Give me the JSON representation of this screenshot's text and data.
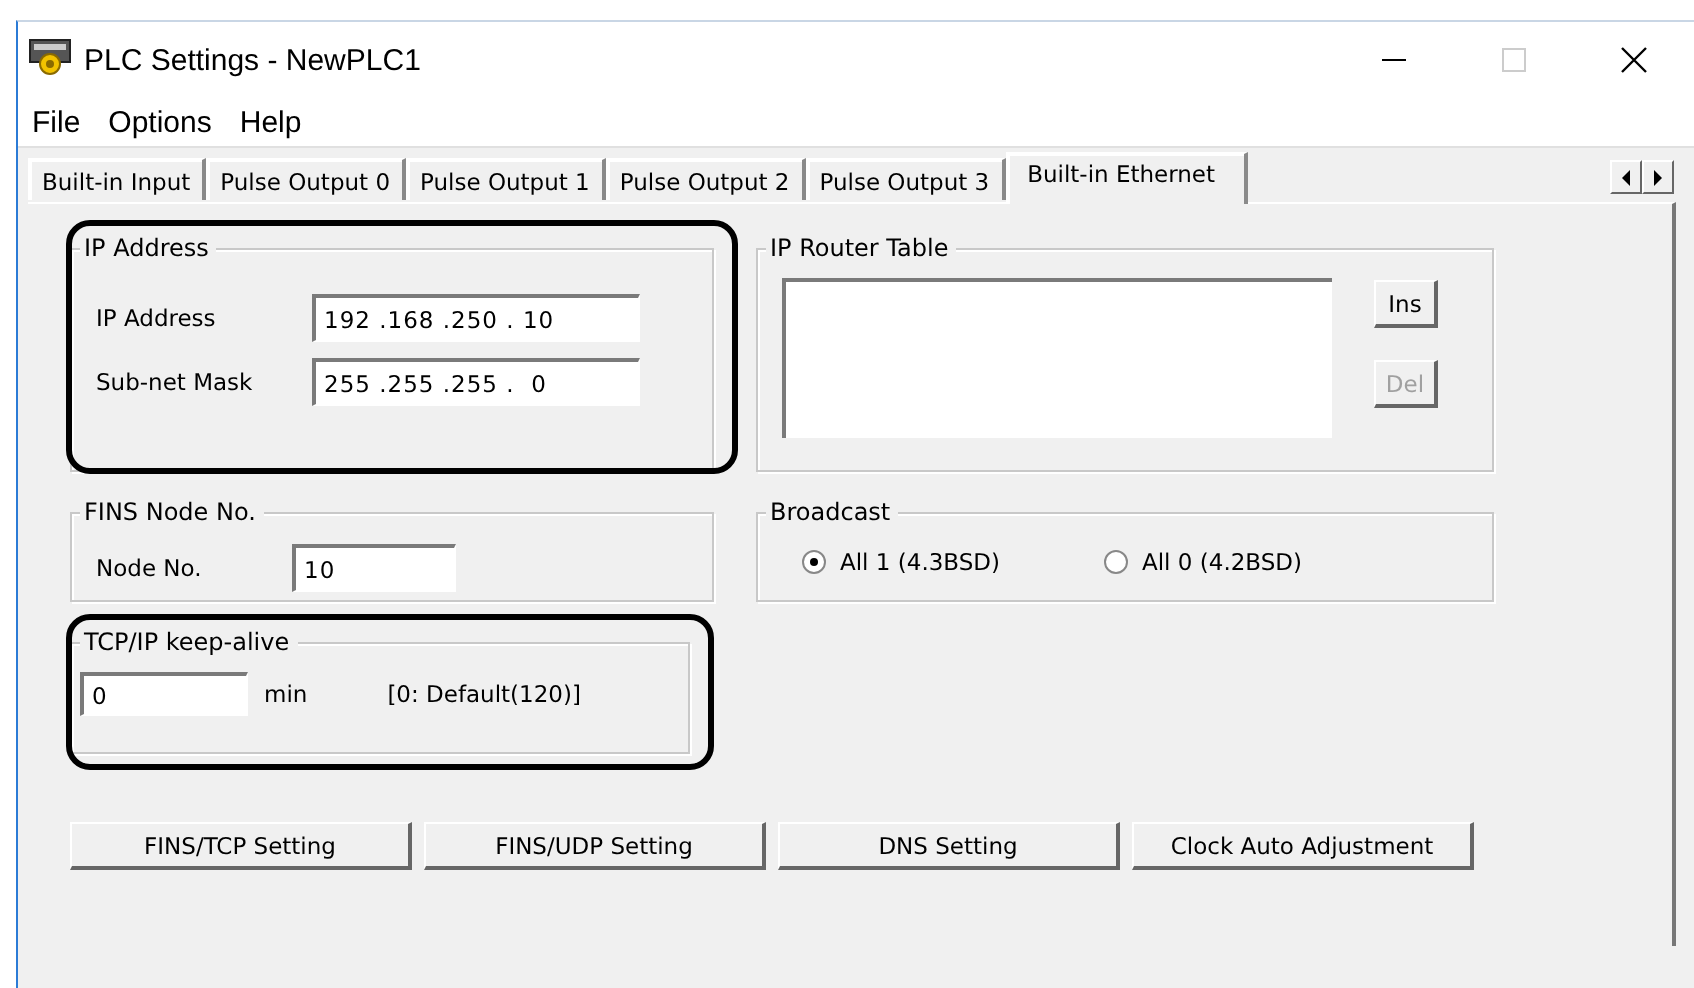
{
  "window": {
    "title": "PLC Settings - NewPLC1"
  },
  "menu": [
    "File",
    "Options",
    "Help"
  ],
  "tabs": [
    {
      "label": "Built-in Input",
      "selected": false
    },
    {
      "label": "Pulse Output 0",
      "selected": false
    },
    {
      "label": "Pulse Output 1",
      "selected": false
    },
    {
      "label": "Pulse Output 2",
      "selected": false
    },
    {
      "label": "Pulse Output 3",
      "selected": false
    },
    {
      "label": "Built-in Ethernet",
      "selected": true
    }
  ],
  "ip_address": {
    "title": "IP Address",
    "highlighted": true,
    "fields": [
      {
        "label": "IP Address",
        "value": "192 .168 .250 . 10"
      },
      {
        "label": "Sub-net Mask",
        "value": "255 .255 .255 .  0"
      }
    ]
  },
  "ip_router_table": {
    "title": "IP Router Table",
    "highlighted": false,
    "buttons": [
      {
        "label": "Ins",
        "disabled": false
      },
      {
        "label": "Del",
        "disabled": true
      }
    ]
  },
  "fins_node": {
    "title": "FINS Node No.",
    "highlighted": false,
    "label": "Node No.",
    "value": "10"
  },
  "broadcast": {
    "title": "Broadcast",
    "highlighted": false,
    "options": [
      {
        "label": "All 1 (4.3BSD)",
        "selected": true
      },
      {
        "label": "All 0 (4.2BSD)",
        "selected": false
      }
    ]
  },
  "keep_alive": {
    "title": "TCP/IP keep-alive",
    "highlighted": true,
    "value": "0",
    "unit": "min",
    "note": "[0: Default(120)]"
  },
  "buttons": [
    "FINS/TCP Setting",
    "FINS/UDP Setting",
    "DNS Setting",
    "Clock Auto Adjustment"
  ]
}
